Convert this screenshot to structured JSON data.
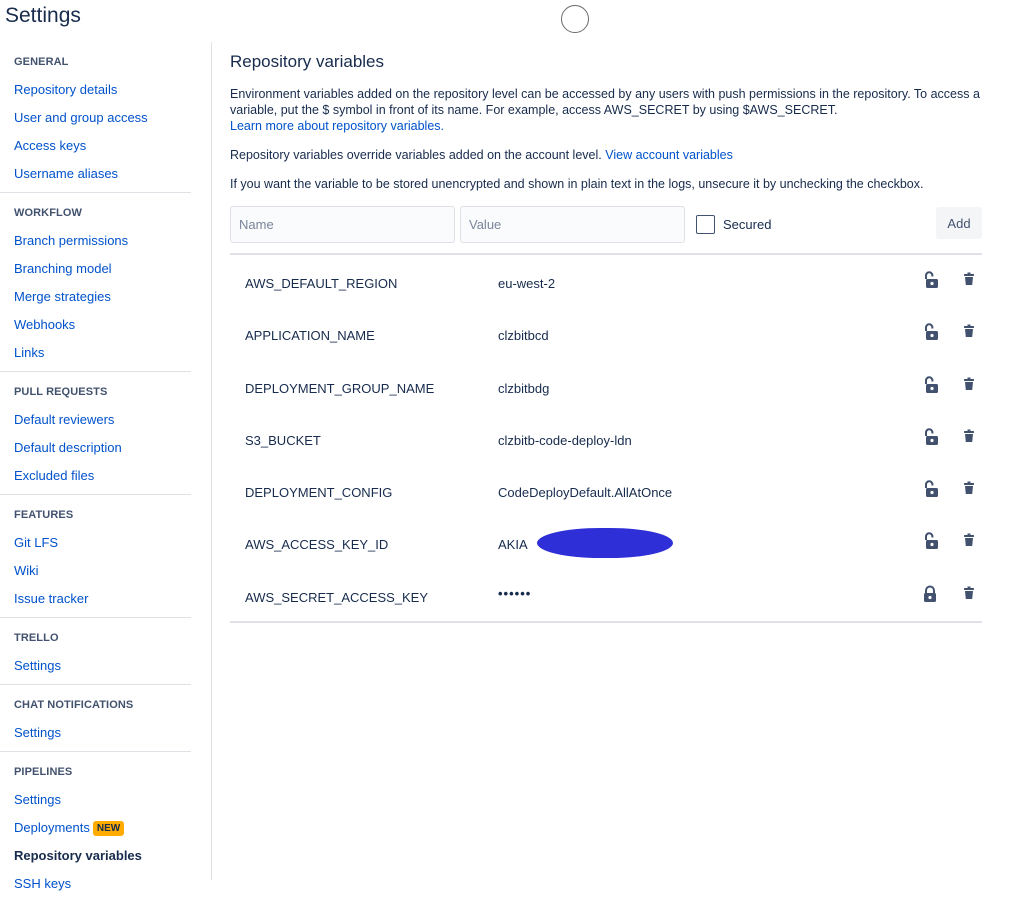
{
  "header": {
    "title": "Settings"
  },
  "sidebar": {
    "sections": [
      {
        "heading": "GENERAL",
        "items": [
          "Repository details",
          "User and group access",
          "Access keys",
          "Username aliases"
        ]
      },
      {
        "heading": "WORKFLOW",
        "items": [
          "Branch permissions",
          "Branching model",
          "Merge strategies",
          "Webhooks",
          "Links"
        ]
      },
      {
        "heading": "PULL REQUESTS",
        "items": [
          "Default reviewers",
          "Default description",
          "Excluded files"
        ]
      },
      {
        "heading": "FEATURES",
        "items": [
          "Git LFS",
          "Wiki",
          "Issue tracker"
        ]
      },
      {
        "heading": "TRELLO",
        "items": [
          "Settings"
        ]
      },
      {
        "heading": "CHAT NOTIFICATIONS",
        "items": [
          "Settings"
        ]
      },
      {
        "heading": "PIPELINES",
        "items": [
          "Settings",
          "Deployments",
          "Repository variables",
          "SSH keys"
        ]
      }
    ],
    "new_badge": "NEW",
    "active_item": "Repository variables"
  },
  "main": {
    "title": "Repository variables",
    "description": "Environment variables added on the repository level can be accessed by any users with push permissions in the repository. To access a variable, put the $ symbol in front of its name. For example, access AWS_SECRET by using $AWS_SECRET.",
    "learn_more_link": "Learn more about repository variables.",
    "override_text": "Repository variables override variables added on the account level.",
    "view_account_link": "View account variables",
    "unsecure_text": "If you want the variable to be stored unencrypted and shown in plain text in the logs, unsecure it by unchecking the checkbox.",
    "form": {
      "name_placeholder": "Name",
      "value_placeholder": "Value",
      "secured_label": "Secured",
      "secured_checked": false,
      "add_label": "Add"
    },
    "variables": [
      {
        "name": "AWS_DEFAULT_REGION",
        "value": "eu-west-2",
        "secured": false
      },
      {
        "name": "APPLICATION_NAME",
        "value": "clzbitbcd",
        "secured": false
      },
      {
        "name": "DEPLOYMENT_GROUP_NAME",
        "value": "clzbitbdg",
        "secured": false
      },
      {
        "name": "S3_BUCKET",
        "value": "clzbitb-code-deploy-ldn",
        "secured": false
      },
      {
        "name": "DEPLOYMENT_CONFIG",
        "value": "CodeDeployDefault.AllAtOnce",
        "secured": false
      },
      {
        "name": "AWS_ACCESS_KEY_ID",
        "value": "AKIA",
        "secured": false,
        "redacted": true
      },
      {
        "name": "AWS_SECRET_ACCESS_KEY",
        "value": "••••••",
        "secured": true
      }
    ]
  },
  "colors": {
    "link": "#0052cc",
    "text": "#172b4d",
    "heading": "#42526e",
    "badge": "#ffab00",
    "border": "#dfe1e6",
    "redaction": "#2e2fd6",
    "icon": "#42526e"
  },
  "icons": {
    "unlocked": "lock-open-icon",
    "locked": "lock-icon",
    "delete": "trash-icon"
  }
}
